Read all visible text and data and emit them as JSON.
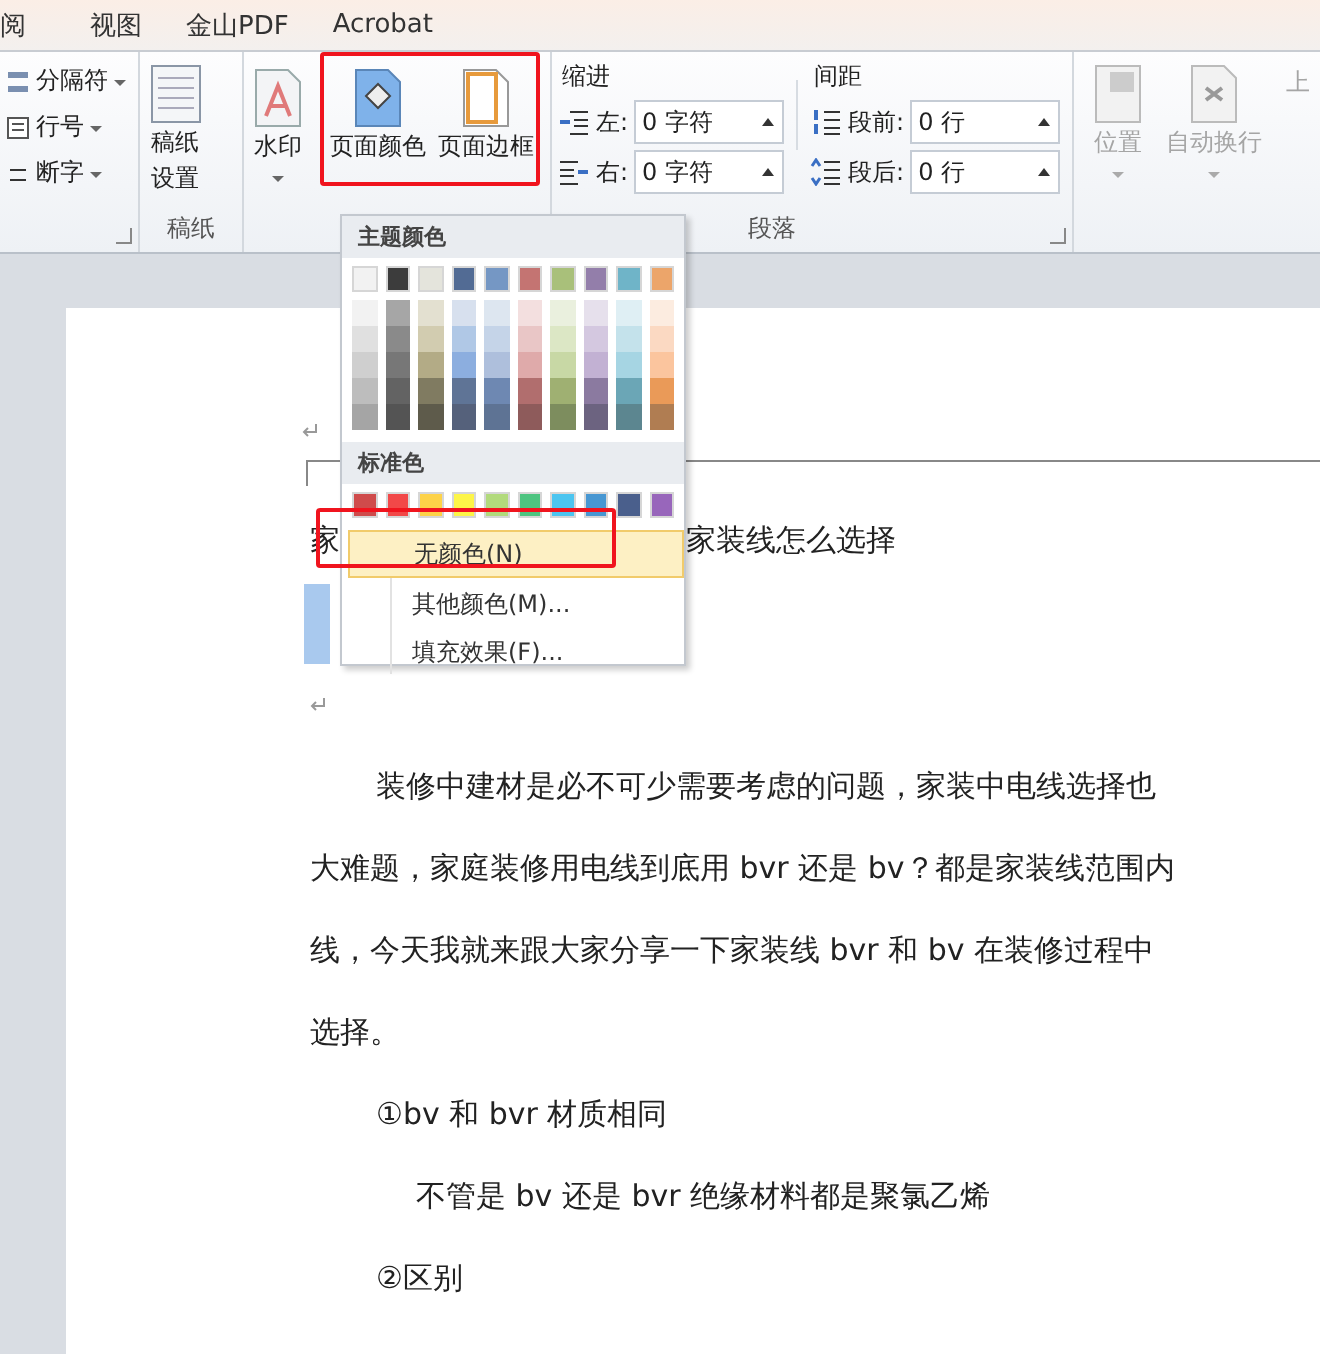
{
  "menu_tabs": [
    {
      "label": "阅",
      "selected": false
    },
    {
      "label": "视图",
      "selected": false
    },
    {
      "label": "金山PDF",
      "selected": false
    },
    {
      "label": "Acrobat",
      "selected": false
    }
  ],
  "ribbon": {
    "page_setup_items": [
      {
        "label": "分隔符",
        "kind": "breaks"
      },
      {
        "label": "行号",
        "kind": "lines"
      },
      {
        "label": "断字",
        "kind": "hyphen"
      }
    ],
    "manuscript": {
      "button": [
        "稿纸",
        "设置"
      ],
      "group_label": "稿纸"
    },
    "background_buttons": [
      {
        "label": "水印",
        "kind": "watermark",
        "dropdown": true
      },
      {
        "label": "页面颜色",
        "kind": "color",
        "dropdown": false
      },
      {
        "label": "页面边框",
        "kind": "border",
        "dropdown": false
      }
    ],
    "paragraph": {
      "indent_label": "缩进",
      "indent": [
        {
          "label": "左:",
          "value": "0 字符",
          "kind": "left"
        },
        {
          "label": "右:",
          "value": "0 字符",
          "kind": "right"
        }
      ],
      "spacing_label": "间距",
      "spacing": [
        {
          "label": "段前:",
          "value": "0 行",
          "kind": "before"
        },
        {
          "label": "段后:",
          "value": "0 行",
          "kind": "after"
        }
      ],
      "group_label": "段落"
    },
    "arrange": [
      {
        "label": "位置",
        "kind": "position",
        "disabled": true
      },
      {
        "label": "自动换行",
        "kind": "wrap",
        "disabled": true
      },
      {
        "label": "上",
        "kind": "cut",
        "disabled": true
      }
    ]
  },
  "color_menu": {
    "theme_label": "主题颜色",
    "theme_colors": [
      {
        "color": "#f2f2f2",
        "shades": [
          {
            "color": "#f2f2f2"
          },
          {
            "color": "#e0e0e0"
          },
          {
            "color": "#cfcfcf"
          },
          {
            "color": "#bdbdbd"
          },
          {
            "color": "#a5a5a5"
          }
        ]
      },
      {
        "color": "#3c3c3c",
        "shades": [
          {
            "color": "#a6a6a6"
          },
          {
            "color": "#8a8a8a"
          },
          {
            "color": "#777777"
          },
          {
            "color": "#636363"
          },
          {
            "color": "#545454"
          }
        ]
      },
      {
        "color": "#e4e4dc",
        "shades": [
          {
            "color": "#e3e0d0"
          },
          {
            "color": "#d2ccb0"
          },
          {
            "color": "#b3ab86"
          },
          {
            "color": "#807b61"
          },
          {
            "color": "#5e5b4b"
          }
        ]
      },
      {
        "color": "#526b94",
        "shades": [
          {
            "color": "#d7e0ee"
          },
          {
            "color": "#b0c8e6"
          },
          {
            "color": "#8caedf"
          },
          {
            "color": "#5f7496"
          },
          {
            "color": "#55617b"
          }
        ]
      },
      {
        "color": "#7597c4",
        "shades": [
          {
            "color": "#dde6f0"
          },
          {
            "color": "#c5d4e8"
          },
          {
            "color": "#aebfdc"
          },
          {
            "color": "#6e88b2"
          },
          {
            "color": "#5e7394"
          }
        ]
      },
      {
        "color": "#c47472",
        "shades": [
          {
            "color": "#f3dfdf"
          },
          {
            "color": "#e9c6c6"
          },
          {
            "color": "#dfaaaa"
          },
          {
            "color": "#b16e6e"
          },
          {
            "color": "#8e5b5b"
          }
        ]
      },
      {
        "color": "#a9c07a",
        "shades": [
          {
            "color": "#eaf0de"
          },
          {
            "color": "#dce7c5"
          },
          {
            "color": "#c8d8a5"
          },
          {
            "color": "#9fb072"
          },
          {
            "color": "#7d8d5e"
          }
        ]
      },
      {
        "color": "#937eaa",
        "shades": [
          {
            "color": "#e6e0ec"
          },
          {
            "color": "#d4c8e0"
          },
          {
            "color": "#c2b1d3"
          },
          {
            "color": "#8b7aa0"
          },
          {
            "color": "#6c6380"
          }
        ]
      },
      {
        "color": "#6fb4c8",
        "shades": [
          {
            "color": "#dfeff4"
          },
          {
            "color": "#c4e2eb"
          },
          {
            "color": "#a6d5e3"
          },
          {
            "color": "#6ba6b6"
          },
          {
            "color": "#5c8690"
          }
        ]
      },
      {
        "color": "#eca56a",
        "shades": [
          {
            "color": "#fcece0"
          },
          {
            "color": "#fbd9c2"
          },
          {
            "color": "#fbc59e"
          },
          {
            "color": "#ea9a58"
          },
          {
            "color": "#b07d52"
          }
        ]
      }
    ],
    "standard_label": "标准色",
    "standard_colors": [
      {
        "color": "#cf4b4b"
      },
      {
        "color": "#f24848"
      },
      {
        "color": "#fdd248"
      },
      {
        "color": "#fdf548"
      },
      {
        "color": "#b2da7c"
      },
      {
        "color": "#4dc480"
      },
      {
        "color": "#4cc5f0"
      },
      {
        "color": "#4897d2"
      },
      {
        "color": "#4a5f8c"
      },
      {
        "color": "#9866bb"
      }
    ],
    "items": [
      {
        "label": "无颜色(N)",
        "selected": true
      },
      {
        "label": "其他颜色(M)...",
        "selected": false
      },
      {
        "label": "填充效果(F)...",
        "selected": false
      }
    ]
  },
  "document": {
    "title_start": "家",
    "title_end": "家装线怎么选择",
    "paragraphs": [
      {
        "kind": "body",
        "lines": [
          "装修中建材是必不可少需要考虑的问题，家装中电线选择也",
          "大难题，家庭装修用电线到底用 bvr 还是 bv？都是家装线范围内",
          "线，今天我就来跟大家分享一下家装线 bvr 和 bv 在装修过程中",
          "选择。"
        ]
      },
      {
        "kind": "heading",
        "lines": [
          "①bv 和 bvr 材质相同"
        ]
      },
      {
        "kind": "note",
        "lines": [
          "不管是 bv 还是 bvr 绝缘材料都是聚氯乙烯"
        ]
      },
      {
        "kind": "heading",
        "lines": [
          "②区别"
        ]
      }
    ]
  }
}
